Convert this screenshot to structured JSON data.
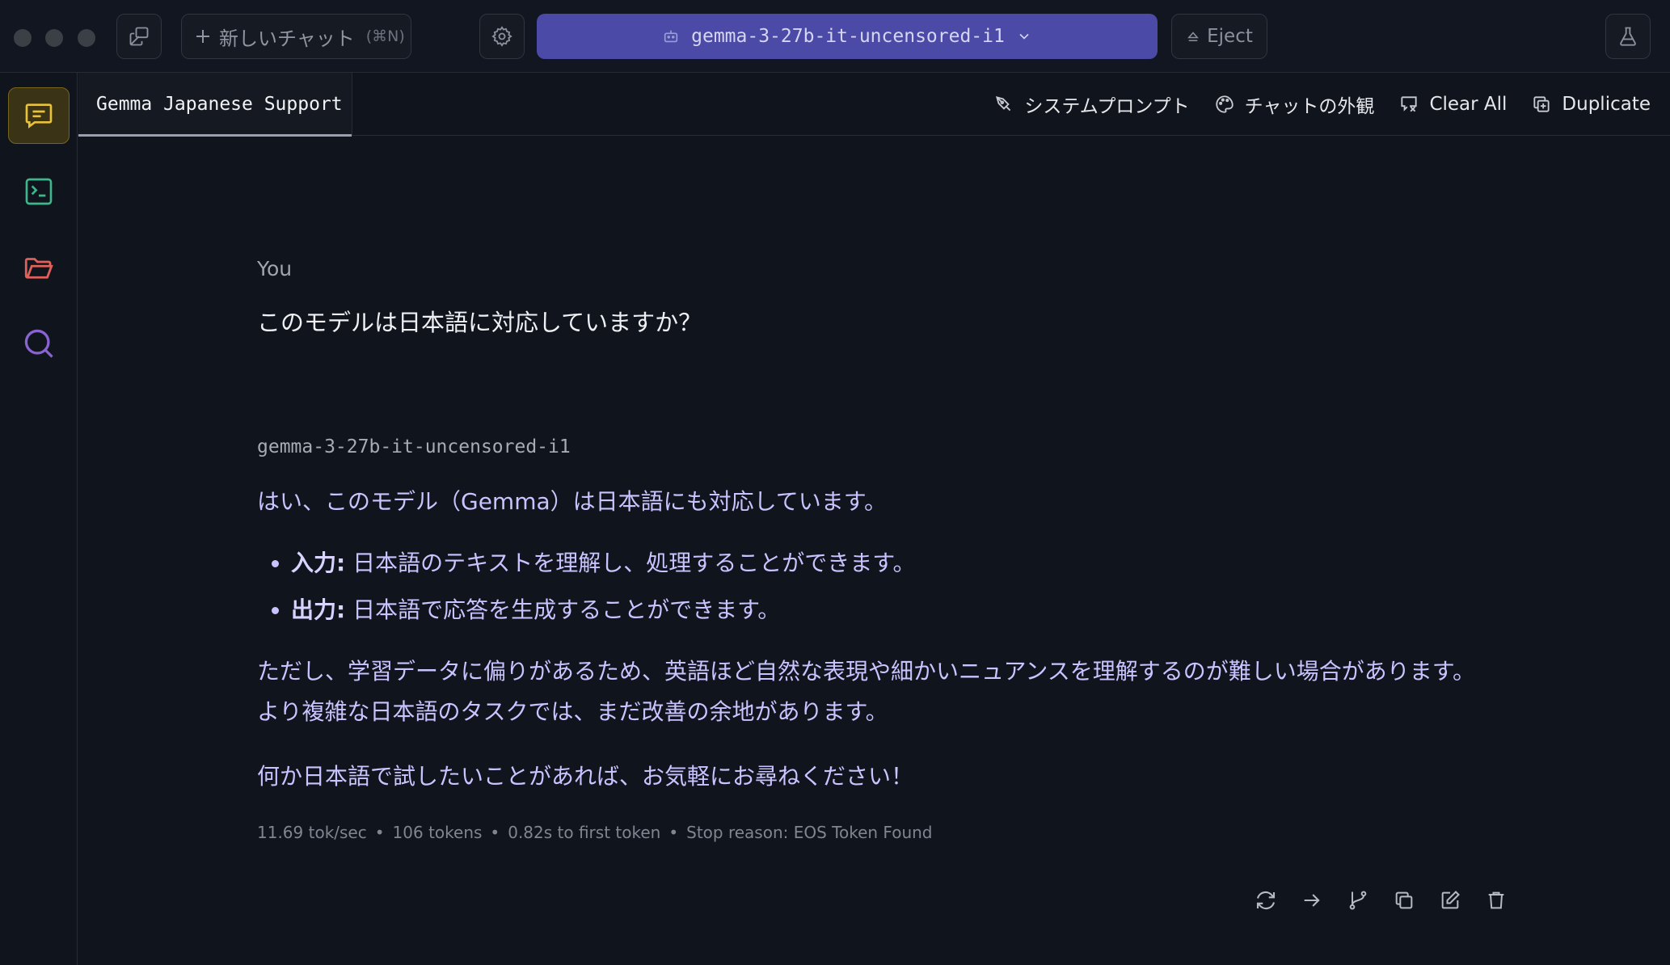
{
  "topbar": {
    "new_chat_label": "新しいチャット",
    "new_chat_shortcut": "(⌘N)",
    "model_name": "gemma-3-27b-it-uncensored-i1",
    "eject_label": "Eject"
  },
  "tab": {
    "title": "Gemma Japanese Support"
  },
  "actions": {
    "system_prompt": "システムプロンプト",
    "appearance": "チャットの外観",
    "clear_all": "Clear All",
    "duplicate": "Duplicate"
  },
  "conversation": {
    "user_sender": "You",
    "user_message": "このモデルは日本語に対応していますか？",
    "model_sender": "gemma-3-27b-it-uncensored-i1",
    "answer_intro": "はい、このモデル（Gemma）は日本語にも対応しています。",
    "bullets": [
      {
        "label": "入力:",
        "text": " 日本語のテキストを理解し、処理することができます。"
      },
      {
        "label": "出力:",
        "text": " 日本語で応答を生成することができます。"
      }
    ],
    "answer_caveat": "ただし、学習データに偏りがあるため、英語ほど自然な表現や細かいニュアンスを理解するのが難しい場合があります。より複雑な日本語のタスクでは、まだ改善の余地があります。",
    "answer_outro": "何か日本語で試したいことがあれば、お気軽にお尋ねください！",
    "stats": {
      "speed": "11.69 tok/sec",
      "tokens": "106 tokens",
      "first_token": "0.82s to first token",
      "stop_reason": "Stop reason: EOS Token Found"
    }
  },
  "colors": {
    "accent_purple": "#4b4aa6",
    "chat_icon_yellow": "#e8c23a",
    "terminal_green": "#3fb68b",
    "folder_red": "#e0605a",
    "search_purple": "#8a63d2"
  }
}
